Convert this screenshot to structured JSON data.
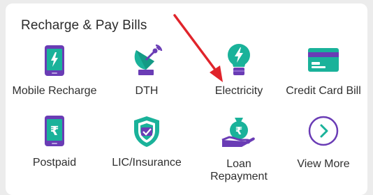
{
  "section": {
    "title": "Recharge & Pay Bills"
  },
  "tiles": [
    {
      "label": "Mobile Recharge",
      "icon": "mobile-phone-icon"
    },
    {
      "label": "DTH",
      "icon": "satellite-dish-icon"
    },
    {
      "label": "Electricity",
      "icon": "lightbulb-icon"
    },
    {
      "label": "Credit Card Bill",
      "icon": "credit-card-icon"
    },
    {
      "label": "Postpaid",
      "icon": "postpaid-phone-icon"
    },
    {
      "label": "LIC/Insurance",
      "icon": "shield-check-icon"
    },
    {
      "label_line1": "Loan",
      "label_line2": "Repayment",
      "icon": "money-bag-hand-icon"
    },
    {
      "label": "View More",
      "icon": "chevron-right-circle-icon"
    }
  ],
  "colors": {
    "purple": "#6a3cb5",
    "teal": "#1ab29a",
    "arrow_red": "#e0242b"
  }
}
